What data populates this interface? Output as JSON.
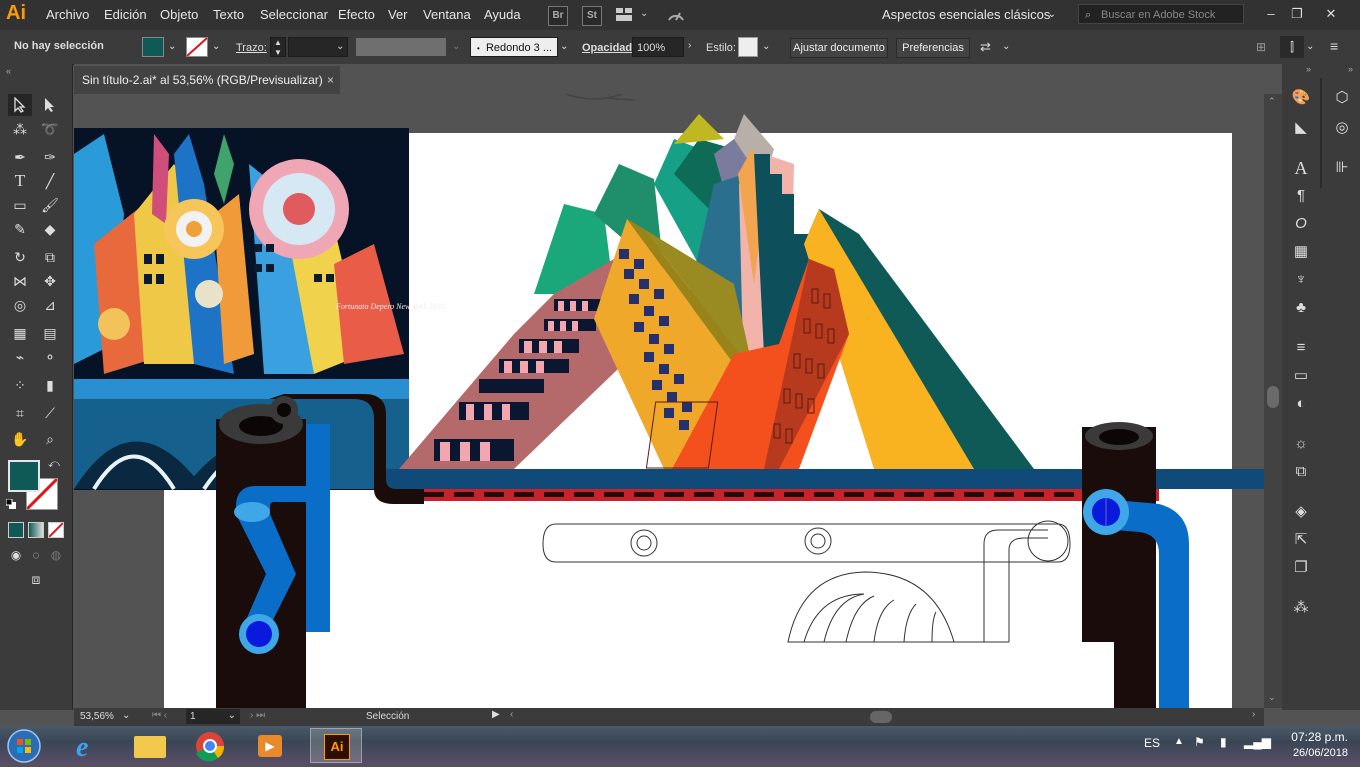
{
  "menubar": {
    "logo": "Ai",
    "items": [
      "Archivo",
      "Edición",
      "Objeto",
      "Texto",
      "Seleccionar",
      "Efecto",
      "Ver",
      "Ventana",
      "Ayuda"
    ],
    "bridge_label": "Br",
    "stock_label": "St",
    "workspace": "Aspectos esenciales clásicos",
    "search_placeholder": "Buscar en Adobe Stock"
  },
  "controlbar": {
    "selection_status": "No hay selección",
    "fill_color": "#0f5a56",
    "stroke_label": "Trazo:",
    "brush_label": "Redondo 3 ...",
    "opacity_label": "Opacidad:",
    "opacity_value": "100%",
    "style_label": "Estilo:",
    "fit_button": "Ajustar documento",
    "prefs_button": "Preferencias"
  },
  "tab": {
    "title": "Sin título-2.ai* al 53,56% (RGB/Previsualizar)",
    "close": "×"
  },
  "statusbar": {
    "zoom": "53,56%",
    "artboard": "1",
    "tool_status": "Selección"
  },
  "artwork": {
    "signature": "Fortunato Depero New York 1930"
  },
  "taskbar": {
    "language": "ES",
    "time": "07:28 p.m.",
    "date": "26/06/2018",
    "ai_label": "Ai"
  },
  "colors": {
    "teal": "#0f5a56",
    "navy_band": "#0f4a78",
    "red_band": "#d8252c",
    "dark_pillar": "#1a0c0a",
    "blue_pipe": "#0a6ec8",
    "yellow": "#f9b321",
    "orange": "#f4501e",
    "mauve": "#b46a6a",
    "green": "#1aa77a"
  }
}
